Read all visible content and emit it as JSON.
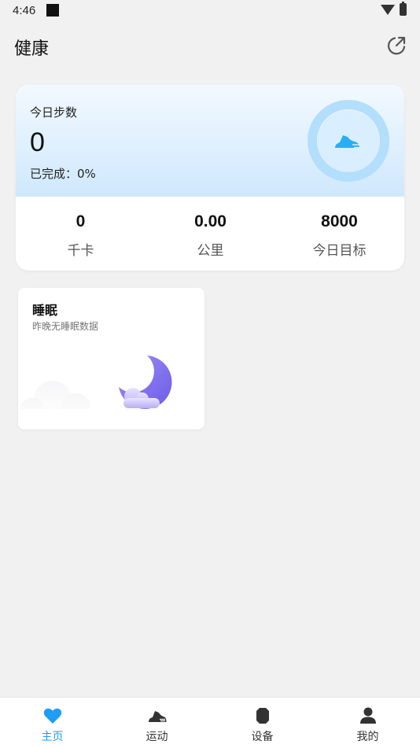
{
  "status_bar": {
    "time": "4:46"
  },
  "header": {
    "title": "健康",
    "share_icon": "share-external-icon"
  },
  "steps_card": {
    "label": "今日步数",
    "steps": "0",
    "completion": "已完成：0%",
    "progress": 0,
    "icon": "running-shoe-icon",
    "stats": [
      {
        "value": "0",
        "label": "千卡"
      },
      {
        "value": "0.00",
        "label": "公里"
      },
      {
        "value": "8000",
        "label": "今日目标"
      }
    ]
  },
  "sleep_card": {
    "title": "睡眠",
    "subtitle": "昨晚无睡眠数据",
    "icon": "moon-icon"
  },
  "bottom_nav": [
    {
      "label": "主页",
      "icon": "heart-icon",
      "active": true
    },
    {
      "label": "运动",
      "icon": "running-shoe-icon",
      "active": false
    },
    {
      "label": "设备",
      "icon": "watch-icon",
      "active": false
    },
    {
      "label": "我的",
      "icon": "person-icon",
      "active": false
    }
  ],
  "colors": {
    "accent": "#1e9df5",
    "background": "#f1f1f1",
    "steps_gradient_top": "#f3f9ff",
    "steps_gradient_bottom": "#cfe8fd",
    "moon": "#7f6ff0"
  }
}
